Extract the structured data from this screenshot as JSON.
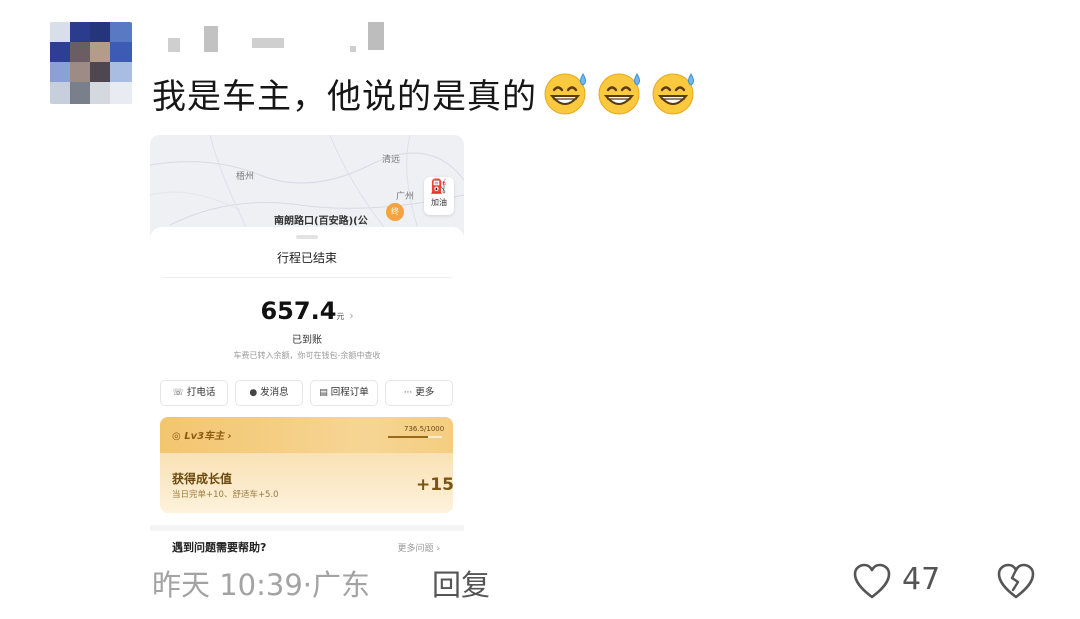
{
  "comment": {
    "text": "我是车主，他说的是真的",
    "emoji_name": "grinning-sweat-emoji",
    "emoji_count": 3,
    "time": "昨天 10:39",
    "location_sep": "·",
    "location": "广东",
    "reply_label": "回复",
    "like_count": "47"
  },
  "screenshot": {
    "map": {
      "cities": [
        "梧州",
        "清远",
        "广州"
      ],
      "destination": "南朗路口(百安路)(公",
      "pin_label": "终",
      "fuel_label": "加油"
    },
    "trip_status": "行程已结束",
    "amount": "657.4",
    "amount_unit": "元",
    "amount_chevron": "›",
    "received": "已到账",
    "note": "车费已转入余额，你可在钱包-余额中查收",
    "actions": [
      {
        "icon": "☏",
        "label": "打电话"
      },
      {
        "icon": "●",
        "label": "发消息"
      },
      {
        "icon": "▤",
        "label": "回程订单"
      },
      {
        "icon": "···",
        "label": "更多"
      }
    ],
    "level": {
      "badge": "Lv3车主 ›",
      "progress_text": "736.5/1000",
      "progress_fraction": 0.7365,
      "gain_title": "获得成长值",
      "gain_detail": "当日完单+10、舒适车+5.0",
      "gain_value": "+15"
    },
    "help": {
      "title": "遇到问题需要帮助?",
      "more": "更多问题 ›"
    }
  },
  "colors": {
    "accent_gold": "#f3c56f",
    "pin_orange": "#f5a243",
    "meta_gray": "#a3a3a3"
  }
}
